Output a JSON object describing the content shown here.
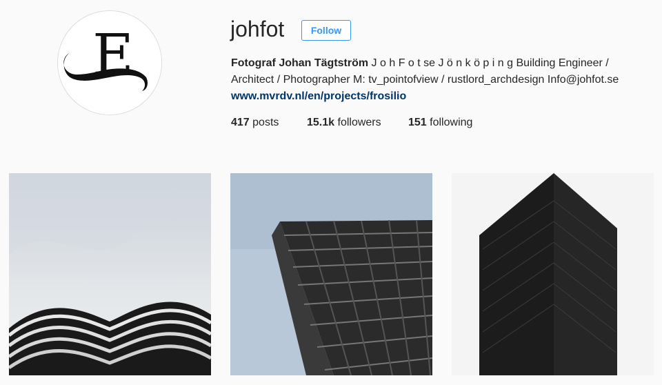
{
  "profile": {
    "username": "johfot",
    "follow_label": "Follow",
    "full_name": "Fotograf Johan Tägtström",
    "bio_text": " J o h F o t se J ö n k ö p i n g Building Engineer / Architect / Photographer M: tv_pointofview / rustlord_archdesign Info@johfot.se",
    "website": "www.mvrdv.nl/en/projects/frosilio",
    "avatar_letter": "E"
  },
  "stats": {
    "posts_count": "417",
    "posts_label": "posts",
    "followers_count": "15.1k",
    "followers_label": "followers",
    "following_count": "151",
    "following_label": "following"
  },
  "colors": {
    "background": "#fafafa",
    "accent": "#3897f0",
    "link": "#003569",
    "text": "#262626"
  }
}
